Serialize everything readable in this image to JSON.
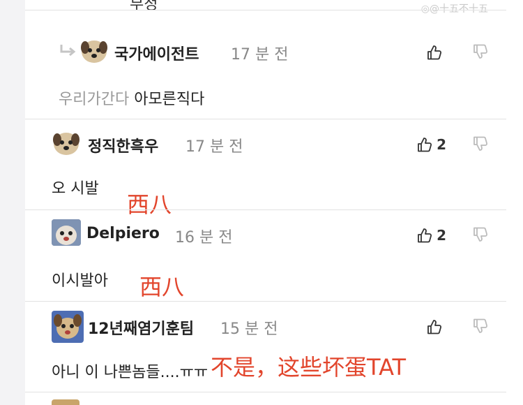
{
  "watermark": "◎@十五不十五",
  "top_cut_text": "부정",
  "time_suffix": "분 전",
  "comments": [
    {
      "is_reply": true,
      "username": "국가에이전트",
      "time": "17 분 전",
      "likes": "",
      "quote": "우리가간다",
      "text": "아모른직다",
      "annotation": ""
    },
    {
      "is_reply": false,
      "username": "정직한흑우",
      "time": "17 분 전",
      "likes": "2",
      "quote": "",
      "text": "오 시발",
      "annotation": "西八"
    },
    {
      "is_reply": false,
      "username": "Delpiero",
      "time": "16 분 전",
      "likes": "2",
      "quote": "",
      "text": "이시발아",
      "annotation": "西八"
    },
    {
      "is_reply": false,
      "username": "12년째염기훈팀",
      "time": "15 분 전",
      "likes": "",
      "quote": "",
      "text": "아니 이 나쁜놈들....ㅠㅠ",
      "annotation": "不是，这些坏蛋TAT"
    }
  ],
  "colors": {
    "annotation": "#e2452c",
    "separator": "#e2e2e2",
    "muted": "#888888"
  }
}
